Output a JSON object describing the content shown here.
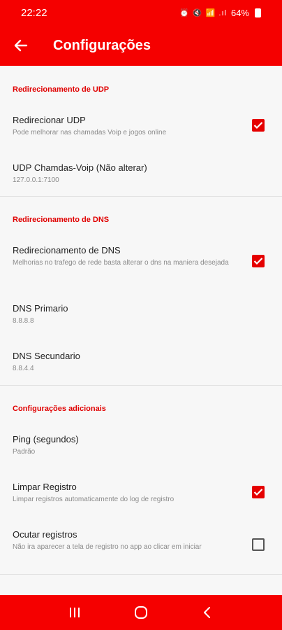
{
  "status_bar": {
    "time": "22:22",
    "icons": "⏰ 🔇 📶 .ıl",
    "battery": "64%"
  },
  "app_bar": {
    "title": "Configurações"
  },
  "sections": [
    {
      "header": "Redirecionamento de UDP"
    },
    {
      "header": "Redirecionamento de DNS"
    },
    {
      "header": "Configurações adicionais"
    }
  ],
  "items": {
    "udp_redirect": {
      "title": "Redirecionar UDP",
      "subtitle": "Pode melhorar nas chamadas Voip e jogos online",
      "checked": true
    },
    "udp_voip": {
      "title": "UDP Chamdas-Voip (Não alterar)",
      "subtitle": "127.0.0.1:7100"
    },
    "dns_redirect": {
      "title": "Redirecionamento de DNS",
      "subtitle": "Melhorias no trafego de rede basta alterar o dns na maniera desejada",
      "checked": true
    },
    "dns_primary": {
      "title": "DNS Primario",
      "subtitle": "8.8.8.8"
    },
    "dns_secondary": {
      "title": "DNS Secundario",
      "subtitle": "8.8.4.4"
    },
    "ping": {
      "title": "Ping (segundos)",
      "subtitle": "Padrão"
    },
    "clear_log": {
      "title": "Limpar Registro",
      "subtitle": "Limpar registros automaticamente do log de registro",
      "checked": true
    },
    "hide_log": {
      "title": "Ocutar registros",
      "subtitle": "Não ira aparecer a tela de registro no app ao clicar em iniciar",
      "checked": false
    }
  },
  "colors": {
    "primary": "#f50000",
    "accent": "#e50000"
  },
  "nav_icons": [
    "recent-apps-icon",
    "home-icon",
    "back-icon"
  ]
}
